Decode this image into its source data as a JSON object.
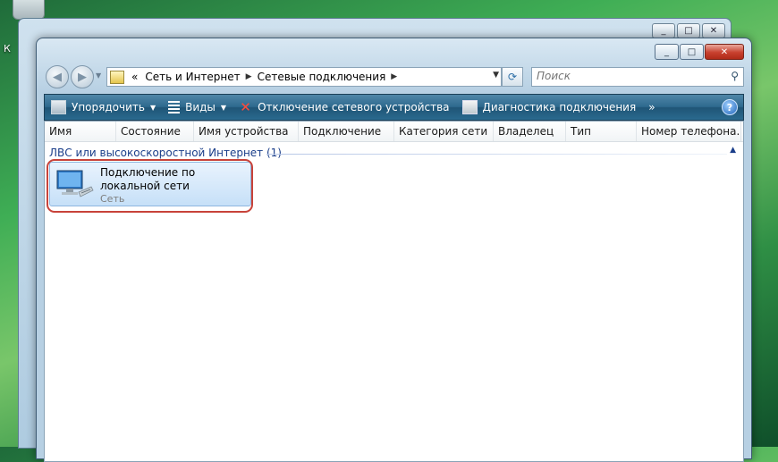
{
  "desktop": {
    "label": "К"
  },
  "window": {
    "controls": {
      "minimize": "_",
      "maximize": "□",
      "close": "✕"
    }
  },
  "nav": {
    "back": "◀",
    "forward": "▶",
    "address": {
      "prefix": "«",
      "segments": [
        "Сеть и Интернет",
        "Сетевые подключения"
      ],
      "arrow": "▶",
      "dropdown": "▼"
    },
    "refresh": "⟳",
    "search": {
      "placeholder": "Поиск",
      "icon": "search-icon"
    }
  },
  "commandbar": {
    "organize": "Упорядочить",
    "views": "Виды",
    "disable": "Отключение сетевого устройства",
    "diagnose": "Диагностика подключения",
    "more": "»",
    "help": "?"
  },
  "columns": [
    "Имя",
    "Состояние",
    "Имя устройства",
    "Подключение",
    "Категория сети",
    "Владелец",
    "Тип",
    "Номер телефона..."
  ],
  "group": {
    "label": "ЛВС или высокоскоростной Интернет (1)",
    "toggle": "▲"
  },
  "item": {
    "title": "Подключение по локальной сети",
    "subtitle": "Сеть",
    "icon": "network-connection-icon"
  },
  "colors": {
    "accent": "#2e6a8e",
    "selection": "#c6e0f8",
    "highlight": "#c8433a"
  }
}
